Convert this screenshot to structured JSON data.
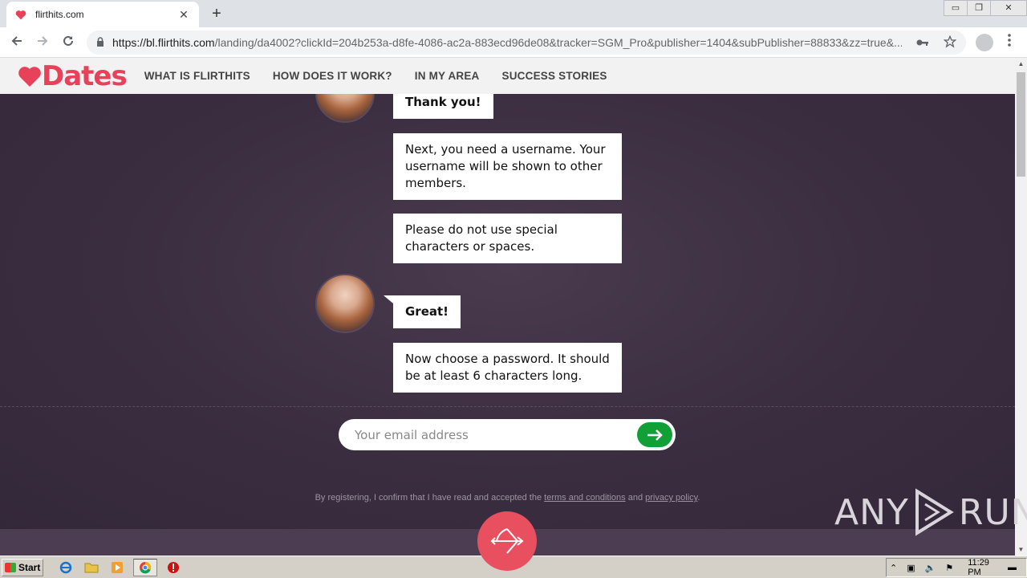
{
  "browser": {
    "tab_title": "flirthits.com",
    "tab_close": "✕",
    "new_tab": "+",
    "window_controls": {
      "minimize": "▭",
      "restore": "❐",
      "close": "✕"
    },
    "url_host": "https://bl.flirthits.com",
    "url_path": "/landing/da4002?clickId=204b253a-d8fe-4086-ac2a-883ecd96de08&tracker=SGM_Pro&publisher=1404&subPublisher=88833&zz=true&..."
  },
  "site": {
    "logo_text": "Dates",
    "brand_color": "#e8425a",
    "nav": [
      {
        "label": "WHAT IS FLIRTHITS"
      },
      {
        "label": "HOW DOES IT WORK?"
      },
      {
        "label": "IN MY AREA"
      },
      {
        "label": "SUCCESS STORIES"
      }
    ]
  },
  "chat": {
    "messages": [
      {
        "text": "Thank you!",
        "bold": true
      },
      {
        "text": "Next, you need a username. Your username will be shown to other members.",
        "bold": false
      },
      {
        "text": "Please do not use special characters or spaces.",
        "bold": false
      },
      {
        "text": "Great!",
        "bold": true
      },
      {
        "text": "Now choose a password. It should be at least 6 characters long.",
        "bold": false
      }
    ]
  },
  "form": {
    "email_placeholder": "Your email address",
    "submit_color": "#11a036"
  },
  "legal": {
    "prefix": "By registering, I confirm that I have read and accepted the",
    "terms_link": "terms and conditions",
    "middle": "and",
    "privacy_link": "privacy policy",
    "suffix": "."
  },
  "watermark": {
    "left": "ANY",
    "right": "RUN"
  },
  "taskbar": {
    "start_label": "Start",
    "clock": "11:29 PM"
  }
}
